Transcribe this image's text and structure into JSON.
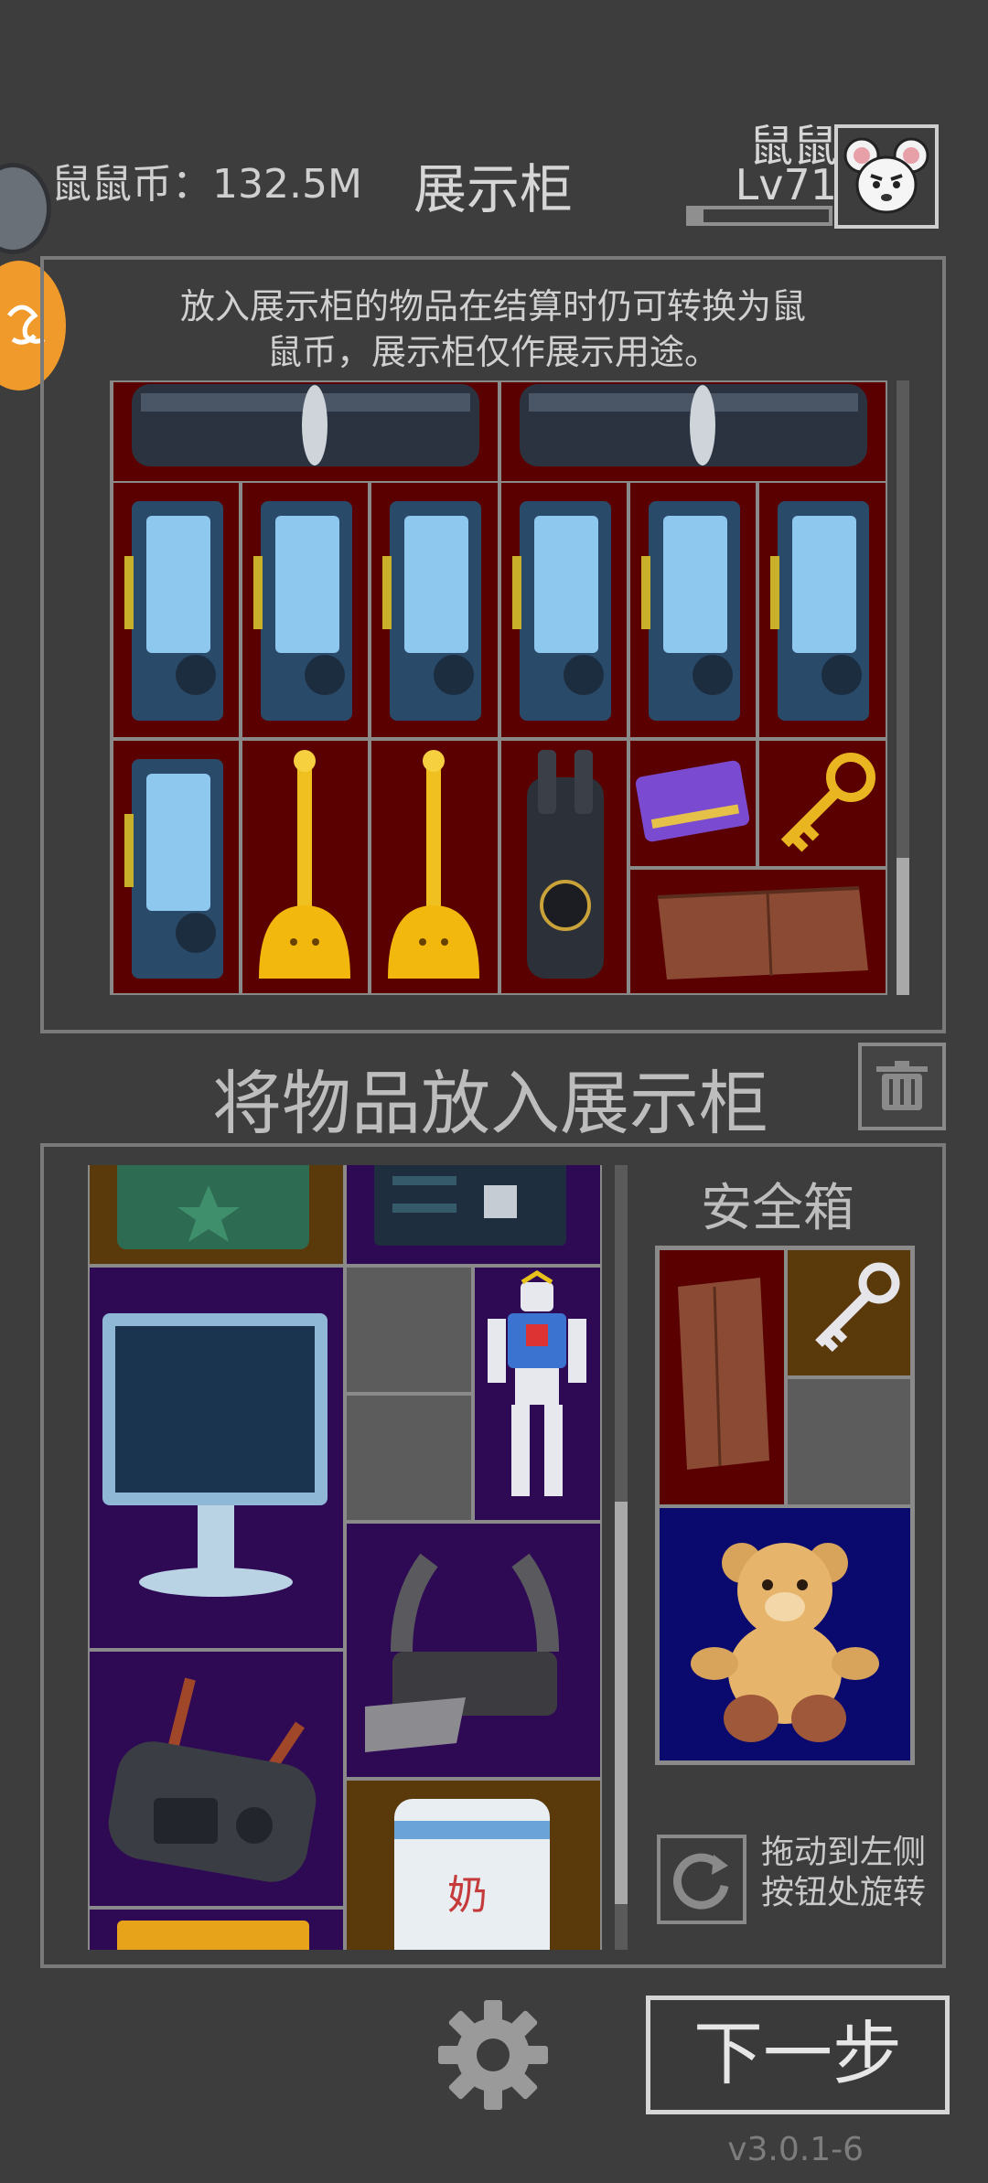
{
  "header": {
    "coin_label": "鼠鼠币：132.5M",
    "title": "展示柜",
    "player_name": "鼠鼠",
    "player_level": "Lv71",
    "xp_progress": 0.1
  },
  "cabinet": {
    "description_line1": "放入展示柜的物品在结算时仍可转换为鼠",
    "description_line2": "鼠币，展示柜仅作展示用途。",
    "items": [
      "rolled-mat",
      "rolled-mat",
      "graphics-card",
      "graphics-card",
      "graphics-card",
      "graphics-card",
      "graphics-card",
      "graphics-card",
      "graphics-card",
      "golden-plunger",
      "golden-plunger",
      "walkie-talkie",
      "purple-keycard",
      "gold-key",
      "leather-folder"
    ]
  },
  "place_section": {
    "title": "将物品放入展示柜"
  },
  "inventory": {
    "items": [
      "green-jerrycan",
      "circuit-board",
      "monitor",
      "empty-slot",
      "empty-slot",
      "robot-figure",
      "tactical-vest",
      "remote-controller",
      "water-jug",
      "gold-bars"
    ],
    "safe_box_title": "安全箱",
    "safe_items": [
      "leather-folder",
      "silver-key",
      "empty-slot",
      "teddy-bear"
    ],
    "rotate_hint_line1": "拖动到左侧",
    "rotate_hint_line2": "按钮处旋转"
  },
  "footer": {
    "next_label": "下一步",
    "version": "v3.0.1-6"
  },
  "colors": {
    "background": "#3d3d3d",
    "cabinet_cell": "#5a0000",
    "inventory_purple": "#2e0a55",
    "inventory_brown": "#5a3a0a",
    "safe_navy": "#0a0a6e",
    "accent_orange": "#f19a2c"
  }
}
